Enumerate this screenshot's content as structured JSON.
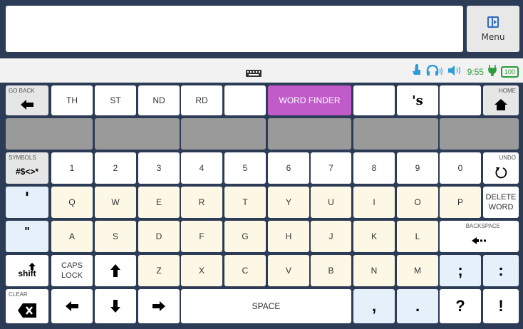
{
  "menu": {
    "label": "Menu"
  },
  "status": {
    "time": "9:55",
    "battery": "100"
  },
  "row1": {
    "go_back": "GO BACK",
    "keys": [
      "TH",
      "ST",
      "ND",
      "RD",
      "",
      "WORD FINDER",
      "",
      "'s",
      ""
    ],
    "home": "HOME"
  },
  "row3": {
    "symbols_label": "SYMBOLS",
    "symbols_value": "#$<>*",
    "digits": [
      "1",
      "2",
      "3",
      "4",
      "5",
      "6",
      "7",
      "8",
      "9",
      "0"
    ],
    "undo": "UNDO"
  },
  "row4": {
    "left_punct": "'",
    "letters": [
      "Q",
      "W",
      "E",
      "R",
      "T",
      "Y",
      "U",
      "I",
      "O",
      "P"
    ],
    "delete_word_1": "DELETE",
    "delete_word_2": "WORD"
  },
  "row5": {
    "left_punct": "\"",
    "letters": [
      "A",
      "S",
      "D",
      "F",
      "G",
      "H",
      "J",
      "K",
      "L"
    ],
    "backspace": "BACKSPACE"
  },
  "row6": {
    "shift": "shift",
    "caps_1": "CAPS",
    "caps_2": "LOCK",
    "letters": [
      "Z",
      "X",
      "C",
      "V",
      "B",
      "N",
      "M"
    ],
    "semicolon": ";",
    "colon": ":"
  },
  "row7": {
    "clear": "CLEAR",
    "space": "SPACE",
    "comma": ",",
    "period": ".",
    "question": "?",
    "exclaim": "!"
  }
}
